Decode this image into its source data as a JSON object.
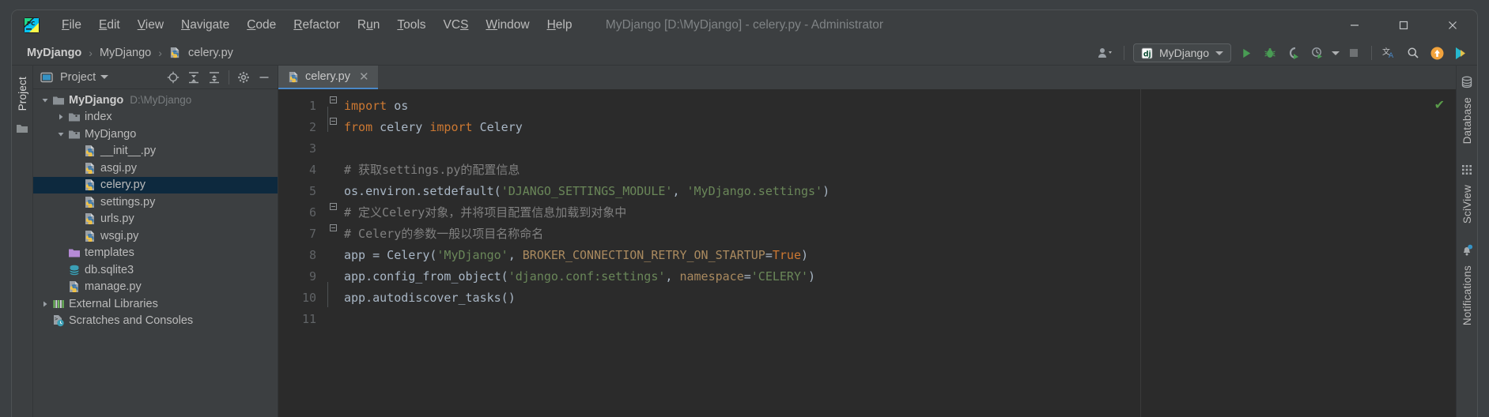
{
  "window": {
    "title": "MyDjango [D:\\MyDjango] - celery.py - Administrator",
    "minimize": "—",
    "maximize": "□",
    "close": "✕",
    "logo_name": "pycharm-logo-icon"
  },
  "menu": {
    "items": [
      {
        "label": "File",
        "mnemonic": "F"
      },
      {
        "label": "Edit",
        "mnemonic": "E"
      },
      {
        "label": "View",
        "mnemonic": "V"
      },
      {
        "label": "Navigate",
        "mnemonic": "N"
      },
      {
        "label": "Code",
        "mnemonic": "C"
      },
      {
        "label": "Refactor",
        "mnemonic": "R"
      },
      {
        "label": "Run",
        "mnemonic": "u"
      },
      {
        "label": "Tools",
        "mnemonic": "T"
      },
      {
        "label": "VCS",
        "mnemonic": "S"
      },
      {
        "label": "Window",
        "mnemonic": "W"
      },
      {
        "label": "Help",
        "mnemonic": "H"
      }
    ]
  },
  "breadcrumb": {
    "separator": "›",
    "items": [
      {
        "label": "MyDjango",
        "bold": true,
        "icon": ""
      },
      {
        "label": "MyDjango",
        "bold": false,
        "icon": ""
      },
      {
        "label": "celery.py",
        "bold": false,
        "icon": "python-file-icon"
      }
    ]
  },
  "toolbar": {
    "account_label": "account-icon",
    "run_config": {
      "label": "MyDjango",
      "icon": "django-icon"
    },
    "buttons": [
      {
        "name": "run-button",
        "label": "Run"
      },
      {
        "name": "debug-button",
        "label": "Debug"
      },
      {
        "name": "coverage-button",
        "label": "Run with Coverage"
      },
      {
        "name": "profile-button",
        "label": "Profile"
      },
      {
        "name": "stop-button",
        "label": "Stop"
      },
      {
        "name": "translate-button",
        "label": "Translate"
      },
      {
        "name": "search-button",
        "label": "Search Everywhere"
      },
      {
        "name": "update-button",
        "label": "Update Project"
      },
      {
        "name": "feature-button",
        "label": "AI Assistant"
      }
    ]
  },
  "left_strip": {
    "items": [
      {
        "label": "Project",
        "active": true,
        "icon": "project-icon"
      },
      {
        "label": "",
        "active": false,
        "icon": "structure-icon"
      }
    ]
  },
  "project_panel": {
    "title": "Project",
    "header_buttons": [
      {
        "name": "scroll-from-source-button",
        "icon": "target-icon"
      },
      {
        "name": "expand-all-button",
        "icon": "expand-all-icon"
      },
      {
        "name": "collapse-all-button",
        "icon": "collapse-all-icon"
      },
      {
        "name": "settings-button",
        "icon": "gear-icon"
      },
      {
        "name": "hide-button",
        "icon": "minus-icon"
      }
    ],
    "tree": [
      {
        "label": "MyDjango",
        "sub": "D:\\MyDjango",
        "indent": 0,
        "arrow": "down",
        "icon": "folder-root-icon",
        "bold": true,
        "selected": false
      },
      {
        "label": "index",
        "sub": "",
        "indent": 1,
        "arrow": "right",
        "icon": "folder-module-icon",
        "bold": false,
        "selected": false
      },
      {
        "label": "MyDjango",
        "sub": "",
        "indent": 1,
        "arrow": "down",
        "icon": "folder-module-icon",
        "bold": false,
        "selected": false
      },
      {
        "label": "__init__.py",
        "sub": "",
        "indent": 2,
        "arrow": "none",
        "icon": "python-file-icon",
        "bold": false,
        "selected": false
      },
      {
        "label": "asgi.py",
        "sub": "",
        "indent": 2,
        "arrow": "none",
        "icon": "python-file-icon",
        "bold": false,
        "selected": false
      },
      {
        "label": "celery.py",
        "sub": "",
        "indent": 2,
        "arrow": "none",
        "icon": "python-file-icon",
        "bold": false,
        "selected": true
      },
      {
        "label": "settings.py",
        "sub": "",
        "indent": 2,
        "arrow": "none",
        "icon": "python-file-icon",
        "bold": false,
        "selected": false
      },
      {
        "label": "urls.py",
        "sub": "",
        "indent": 2,
        "arrow": "none",
        "icon": "python-file-icon",
        "bold": false,
        "selected": false
      },
      {
        "label": "wsgi.py",
        "sub": "",
        "indent": 2,
        "arrow": "none",
        "icon": "python-file-icon",
        "bold": false,
        "selected": false
      },
      {
        "label": "templates",
        "sub": "",
        "indent": 1,
        "arrow": "none",
        "icon": "folder-templates-icon",
        "bold": false,
        "selected": false
      },
      {
        "label": "db.sqlite3",
        "sub": "",
        "indent": 1,
        "arrow": "none",
        "icon": "database-file-icon",
        "bold": false,
        "selected": false
      },
      {
        "label": "manage.py",
        "sub": "",
        "indent": 1,
        "arrow": "none",
        "icon": "python-file-icon",
        "bold": false,
        "selected": false
      },
      {
        "label": "External Libraries",
        "sub": "",
        "indent": 0,
        "arrow": "right",
        "icon": "libraries-icon",
        "bold": false,
        "selected": false
      },
      {
        "label": "Scratches and Consoles",
        "sub": "",
        "indent": 0,
        "arrow": "none",
        "icon": "scratches-icon",
        "bold": false,
        "selected": false
      }
    ]
  },
  "editor": {
    "tab": {
      "label": "celery.py",
      "icon": "python-file-icon",
      "close": "✕"
    },
    "inspection_status": "✔",
    "line_numbers": [
      "1",
      "2",
      "3",
      "4",
      "5",
      "6",
      "7",
      "8",
      "9",
      "10",
      "11"
    ],
    "lines": [
      {
        "n": 1,
        "tokens": [
          {
            "t": "import",
            "c": "k"
          },
          {
            "t": " os",
            "c": "n"
          }
        ]
      },
      {
        "n": 2,
        "tokens": [
          {
            "t": "from",
            "c": "k"
          },
          {
            "t": " celery ",
            "c": "n"
          },
          {
            "t": "import",
            "c": "k"
          },
          {
            "t": " Celery",
            "c": "n"
          }
        ]
      },
      {
        "n": 3,
        "tokens": []
      },
      {
        "n": 4,
        "tokens": [
          {
            "t": "# 获取settings.py的配置信息",
            "c": "cm"
          }
        ]
      },
      {
        "n": 5,
        "tokens": [
          {
            "t": "os.environ.setdefault(",
            "c": "n"
          },
          {
            "t": "'DJANGO_SETTINGS_MODULE'",
            "c": "s"
          },
          {
            "t": ", ",
            "c": "n"
          },
          {
            "t": "'MyDjango.settings'",
            "c": "s"
          },
          {
            "t": ")",
            "c": "n"
          }
        ]
      },
      {
        "n": 6,
        "tokens": [
          {
            "t": "# 定义Celery对象，并将项目配置信息加载到对象中",
            "c": "cm"
          }
        ]
      },
      {
        "n": 7,
        "tokens": [
          {
            "t": "# Celery的参数一般以项目名称命名",
            "c": "cm"
          }
        ]
      },
      {
        "n": 8,
        "tokens": [
          {
            "t": "app = Celery(",
            "c": "n"
          },
          {
            "t": "'MyDjango'",
            "c": "s"
          },
          {
            "t": ", ",
            "c": "n"
          },
          {
            "t": "BROKER_CONNECTION_RETRY_ON_STARTUP",
            "c": "kw"
          },
          {
            "t": "=",
            "c": "n"
          },
          {
            "t": "True",
            "c": "cn"
          },
          {
            "t": ")",
            "c": "n"
          }
        ]
      },
      {
        "n": 9,
        "tokens": [
          {
            "t": "app.config_from_object(",
            "c": "n"
          },
          {
            "t": "'django.conf:settings'",
            "c": "s"
          },
          {
            "t": ", ",
            "c": "n"
          },
          {
            "t": "namespace",
            "c": "kw"
          },
          {
            "t": "=",
            "c": "n"
          },
          {
            "t": "'CELERY'",
            "c": "s"
          },
          {
            "t": ")",
            "c": "n"
          }
        ]
      },
      {
        "n": 10,
        "tokens": [
          {
            "t": "app.autodiscover_tasks()",
            "c": "n"
          }
        ]
      },
      {
        "n": 11,
        "tokens": []
      }
    ]
  },
  "right_strip": {
    "items": [
      {
        "label": "Database",
        "icon": "database-icon"
      },
      {
        "label": "SciView",
        "icon": "sciview-icon"
      },
      {
        "label": "Notifications",
        "icon": "bell-icon",
        "badge": true
      }
    ]
  },
  "colors": {
    "panel_bg": "#3c3f41",
    "editor_bg": "#2b2b2b",
    "selection": "#0d293e",
    "accent": "#4a88c7",
    "keyword": "#cc7832",
    "string": "#6a8759",
    "comment": "#808080",
    "text": "#a9b7c6",
    "named_arg": "#aa8a5f",
    "run_green": "#499c54"
  }
}
